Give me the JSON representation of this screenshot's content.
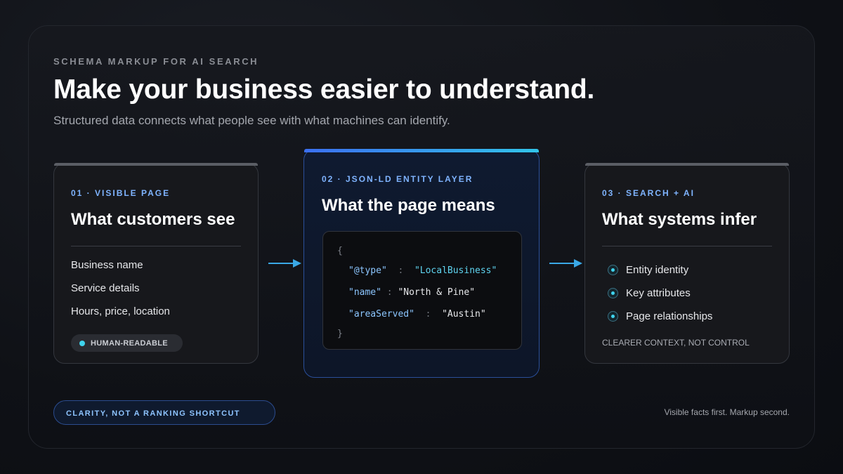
{
  "header": {
    "eyebrow": "SCHEMA MARKUP FOR AI SEARCH",
    "title": "Make your business easier to understand.",
    "subtitle": "Structured data connects what people see with what machines can identify."
  },
  "cards": {
    "visible_page": {
      "step": "01 · VISIBLE PAGE",
      "title": "What customers see",
      "items": [
        "Business name",
        "Service details",
        "Hours, price, location"
      ],
      "badge": "HUMAN-READABLE"
    },
    "entity_layer": {
      "step": "02 · JSON-LD ENTITY LAYER",
      "title": "What the page means",
      "code": {
        "open": "{",
        "close": "}",
        "lines": [
          {
            "key": "\"@type\"",
            "sep": ":",
            "value": "\"LocalBusiness\""
          },
          {
            "key": "\"name\"",
            "sep": ":",
            "value": "\"North & Pine\""
          },
          {
            "key": "\"areaServed\"",
            "sep": ":",
            "value": "\"Austin\""
          }
        ]
      }
    },
    "search_ai": {
      "step": "03 · SEARCH + AI",
      "title": "What systems infer",
      "items": [
        "Entity identity",
        "Key attributes",
        "Page relationships"
      ],
      "note": "CLEARER CONTEXT, NOT CONTROL"
    }
  },
  "footer": {
    "badge": "CLARITY, NOT A RANKING SHORTCUT",
    "tagline": "Visible facts first. Markup second."
  },
  "colors": {
    "accent_blue": "#7fb4ff",
    "accent_cyan": "#3fd4ee",
    "arrow": "#3aa8e6",
    "background": "#0f1116"
  },
  "icons": {
    "arrow": "arrow-right-icon",
    "badge_dot": "status-dot-icon",
    "bullet": "radio-bullet-icon"
  }
}
